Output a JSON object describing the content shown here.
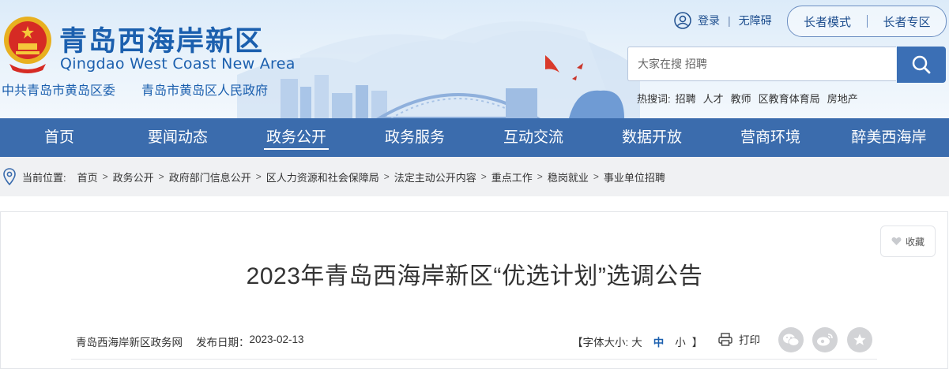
{
  "header": {
    "site_name_cn": "青岛西海岸新区",
    "site_name_en": "Qingdao West Coast New Area",
    "party_committee": "中共青岛市黄岛区委",
    "government": "青岛市黄岛区人民政府",
    "login": "登录",
    "accessibility": "无障碍",
    "elder_mode": "长者模式",
    "elder_zone": "长者专区",
    "search": {
      "placeholder": "大家在搜 招聘"
    },
    "hot_search": {
      "label": "热搜词:",
      "keywords": [
        "招聘",
        "人才",
        "教师",
        "区教育体育局",
        "房地产"
      ]
    }
  },
  "nav": {
    "items": [
      {
        "label": "首页"
      },
      {
        "label": "要闻动态"
      },
      {
        "label": "政务公开",
        "active": true
      },
      {
        "label": "政务服务"
      },
      {
        "label": "互动交流"
      },
      {
        "label": "数据开放"
      },
      {
        "label": "营商环境"
      },
      {
        "label": "醉美西海岸"
      }
    ]
  },
  "breadcrumb": {
    "label": "当前位置:",
    "items": [
      "首页",
      "政务公开",
      "政府部门信息公开",
      "区人力资源和社会保障局",
      "法定主动公开内容",
      "重点工作",
      "稳岗就业",
      "事业单位招聘"
    ]
  },
  "article": {
    "favorite": "收藏",
    "title": "2023年青岛西海岸新区“优选计划”选调公告",
    "source": "青岛西海岸新区政务网",
    "date_label": "发布日期：",
    "date": "2023-02-13",
    "font_size": {
      "open": "【",
      "label": "字体大小:",
      "large": "大",
      "medium": "中",
      "small": "小",
      "close": "】"
    },
    "print": "打印"
  },
  "colors": {
    "brand_blue": "#1b5fae",
    "nav_bg": "#3b6cad",
    "search_button": "#3b6fb5",
    "breadcrumb_bg": "#f0f1f3"
  },
  "icons": [
    "emblem-icon",
    "user-icon",
    "search-icon",
    "location-pin-icon",
    "heart-icon",
    "printer-icon",
    "wechat-icon",
    "weibo-icon",
    "star-icon"
  ]
}
